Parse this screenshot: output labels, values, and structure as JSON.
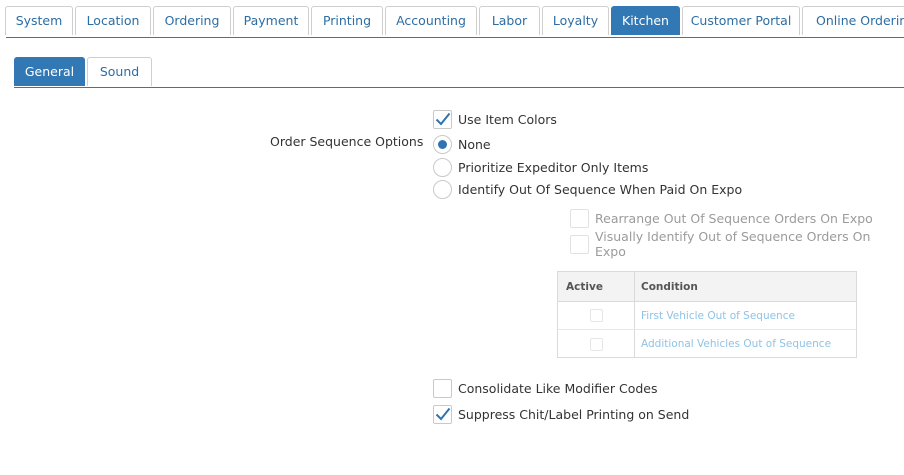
{
  "top_tabs": [
    {
      "label": "System",
      "active": false
    },
    {
      "label": "Location",
      "active": false
    },
    {
      "label": "Ordering",
      "active": false
    },
    {
      "label": "Payment",
      "active": false
    },
    {
      "label": "Printing",
      "active": false
    },
    {
      "label": "Accounting",
      "active": false
    },
    {
      "label": "Labor",
      "active": false
    },
    {
      "label": "Loyalty",
      "active": false
    },
    {
      "label": "Kitchen",
      "active": true
    },
    {
      "label": "Customer Portal",
      "active": false
    },
    {
      "label": "Online Ordering",
      "active": false
    }
  ],
  "sub_tabs": [
    {
      "label": "General",
      "active": true
    },
    {
      "label": "Sound",
      "active": false
    }
  ],
  "settings": {
    "use_item_colors": {
      "label": "Use Item Colors",
      "checked": true
    },
    "order_sequence_label": "Order Sequence Options",
    "order_sequence_options": [
      {
        "label": "None",
        "selected": true
      },
      {
        "label": "Prioritize Expeditor Only Items",
        "selected": false
      },
      {
        "label": "Identify Out Of Sequence When Paid On Expo",
        "selected": false
      }
    ],
    "expo_suboptions": [
      {
        "label": "Rearrange Out Of Sequence Orders On Expo",
        "checked": false,
        "disabled": true
      },
      {
        "label": "Visually Identify Out of Sequence Orders On Expo",
        "checked": false,
        "disabled": true
      }
    ],
    "conditions_table": {
      "headers": {
        "active": "Active",
        "condition": "Condition"
      },
      "rows": [
        {
          "active": false,
          "condition": "First Vehicle Out of Sequence"
        },
        {
          "active": false,
          "condition": "Additional Vehicles Out of Sequence"
        }
      ]
    },
    "consolidate_modifiers": {
      "label": "Consolidate Like Modifier Codes",
      "checked": false
    },
    "suppress_chit": {
      "label": "Suppress Chit/Label Printing on Send",
      "checked": true
    }
  },
  "colors": {
    "accent": "#3278b5",
    "link_disabled": "#8fc3e6"
  }
}
